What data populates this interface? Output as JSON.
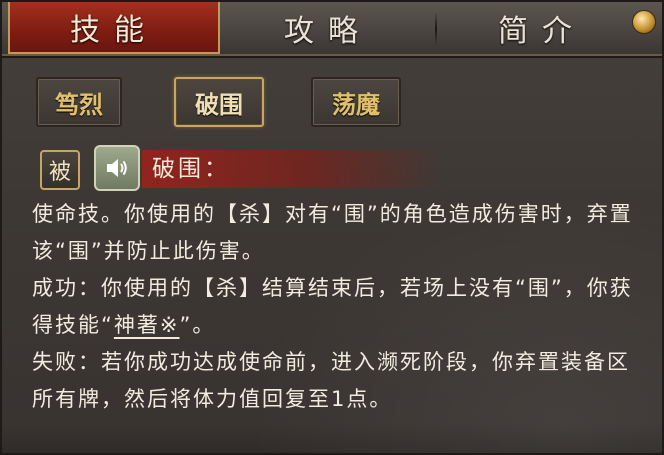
{
  "tabs": [
    {
      "label": "技能",
      "active": true
    },
    {
      "label": "攻略",
      "active": false
    },
    {
      "label": "简介",
      "active": false
    }
  ],
  "sub_tabs": [
    {
      "label": "笃烈",
      "active": false
    },
    {
      "label": "破围",
      "active": true
    },
    {
      "label": "荡魔",
      "active": false
    }
  ],
  "skill": {
    "type_badge": "被",
    "audio_icon": "speaker-icon",
    "name": "破围：",
    "description": {
      "intro": "使命技。你使用的【杀】对有“围”的角色造成伤害时，弃置该“围”并防止此伤害。",
      "success_prefix": "成功：你使用的【杀】结算结束后，若场上没有“围”，你获得技能“",
      "success_skill": "神著※",
      "success_suffix": "”。",
      "failure": "失败：若你成功达成使命前，进入濒死阶段，你弃置装备区所有牌，然后将体力值回复至1点。"
    }
  },
  "colors": {
    "active_tab": "#8f2418",
    "gold": "#c9a660",
    "text": "#f1ebe0"
  }
}
